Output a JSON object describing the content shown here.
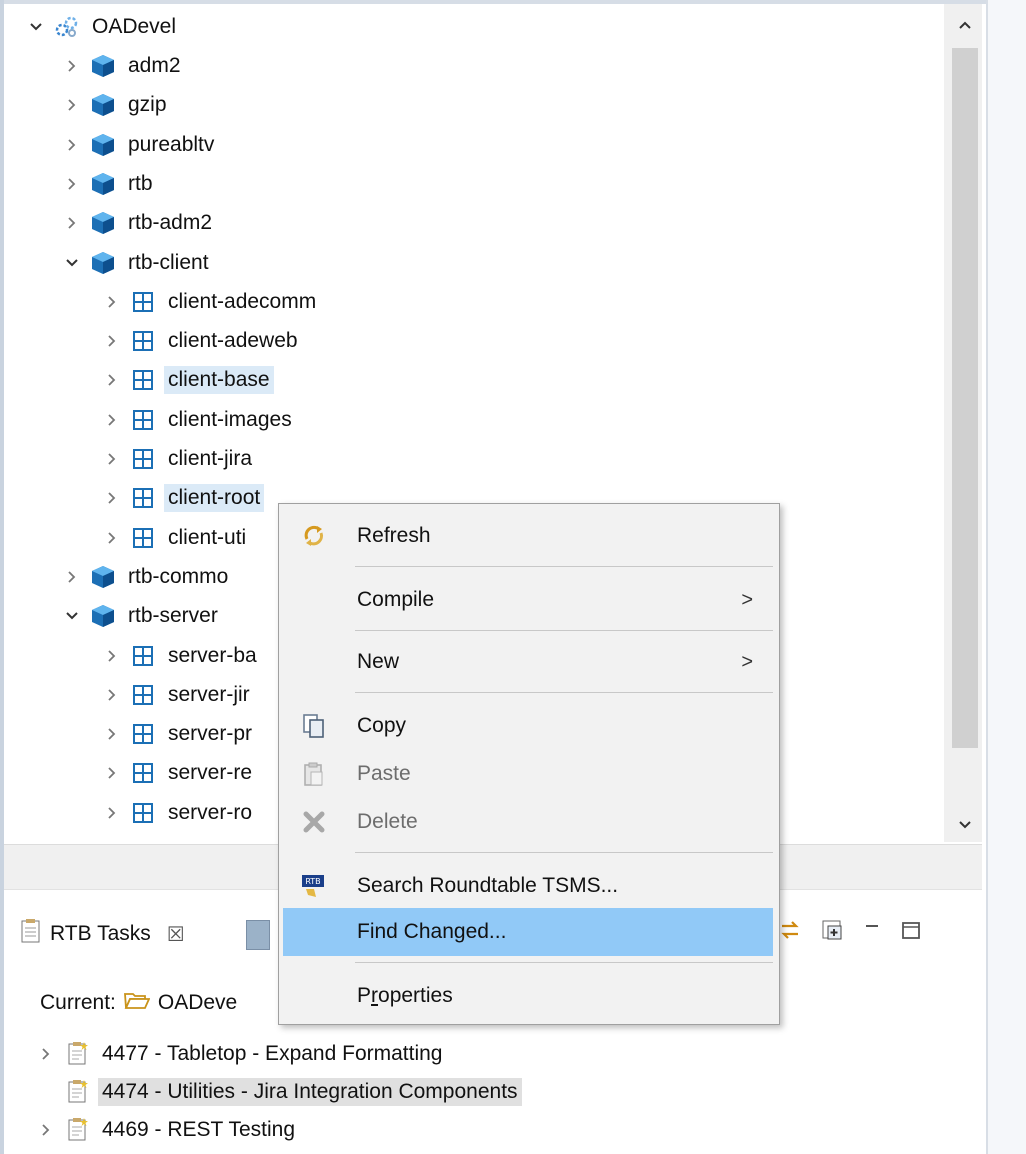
{
  "tree": {
    "root": {
      "label": "OADevel",
      "icon": "workspace-cluster-icon"
    },
    "items": [
      {
        "label": "adm2",
        "level": 1,
        "expanded": false,
        "icon": "module-cube-icon"
      },
      {
        "label": "gzip",
        "level": 1,
        "expanded": false,
        "icon": "module-cube-icon"
      },
      {
        "label": "pureabltv",
        "level": 1,
        "expanded": false,
        "icon": "module-cube-icon"
      },
      {
        "label": "rtb",
        "level": 1,
        "expanded": false,
        "icon": "module-cube-icon"
      },
      {
        "label": "rtb-adm2",
        "level": 1,
        "expanded": false,
        "icon": "module-cube-icon"
      },
      {
        "label": "rtb-client",
        "level": 1,
        "expanded": true,
        "icon": "module-cube-icon"
      },
      {
        "label": "client-adecomm",
        "level": 2,
        "icon": "package-grid-icon"
      },
      {
        "label": "client-adeweb",
        "level": 2,
        "icon": "package-grid-icon"
      },
      {
        "label": "client-base",
        "level": 2,
        "icon": "package-grid-icon",
        "selected": true
      },
      {
        "label": "client-images",
        "level": 2,
        "icon": "package-grid-icon"
      },
      {
        "label": "client-jira",
        "level": 2,
        "icon": "package-grid-icon"
      },
      {
        "label": "client-root",
        "level": 2,
        "icon": "package-grid-icon",
        "selected": true
      },
      {
        "label": "client-uti",
        "level": 2,
        "icon": "package-grid-icon"
      },
      {
        "label": "rtb-commo",
        "level": 1,
        "expanded": false,
        "icon": "module-cube-icon"
      },
      {
        "label": "rtb-server",
        "level": 1,
        "expanded": true,
        "icon": "module-cube-icon"
      },
      {
        "label": "server-ba",
        "level": 2,
        "icon": "package-grid-icon"
      },
      {
        "label": "server-jir",
        "level": 2,
        "icon": "package-grid-icon"
      },
      {
        "label": "server-pr",
        "level": 2,
        "icon": "package-grid-icon"
      },
      {
        "label": "server-re",
        "level": 2,
        "icon": "package-grid-icon"
      },
      {
        "label": "server-ro",
        "level": 2,
        "icon": "package-grid-icon"
      }
    ]
  },
  "context_menu": {
    "items": [
      {
        "label": "Refresh",
        "icon": "refresh-icon"
      },
      {
        "label": "Compile",
        "submenu": true
      },
      {
        "label": "New",
        "submenu": true
      },
      {
        "label": "Copy",
        "icon": "copy-icon"
      },
      {
        "label": "Paste",
        "icon": "paste-icon",
        "disabled": true
      },
      {
        "label": "Delete",
        "icon": "delete-icon",
        "disabled": true
      },
      {
        "label": "Search Roundtable TSMS...",
        "icon": "rtb-search-icon"
      },
      {
        "label": "Find Changed...",
        "highlighted": true
      },
      {
        "label": "Properties",
        "mnemonic": "r"
      }
    ],
    "submenu_arrow": ">"
  },
  "tasks_view": {
    "tab_label": "RTB Tasks",
    "tab_close": "☒",
    "current_label": "Current:",
    "current_value": "OADeve",
    "tasks": [
      {
        "label": "4477 - Tabletop - Expand Formatting",
        "expandable": true
      },
      {
        "label": "4474 - Utilities - Jira Integration Components",
        "expandable": false,
        "selected": true
      },
      {
        "label": "4469 - REST Testing",
        "expandable": true
      }
    ]
  },
  "colors": {
    "accent_selection": "#91c9f7",
    "tree_selection": "#dbeaf7",
    "cube_blue": "#1a73b8"
  }
}
